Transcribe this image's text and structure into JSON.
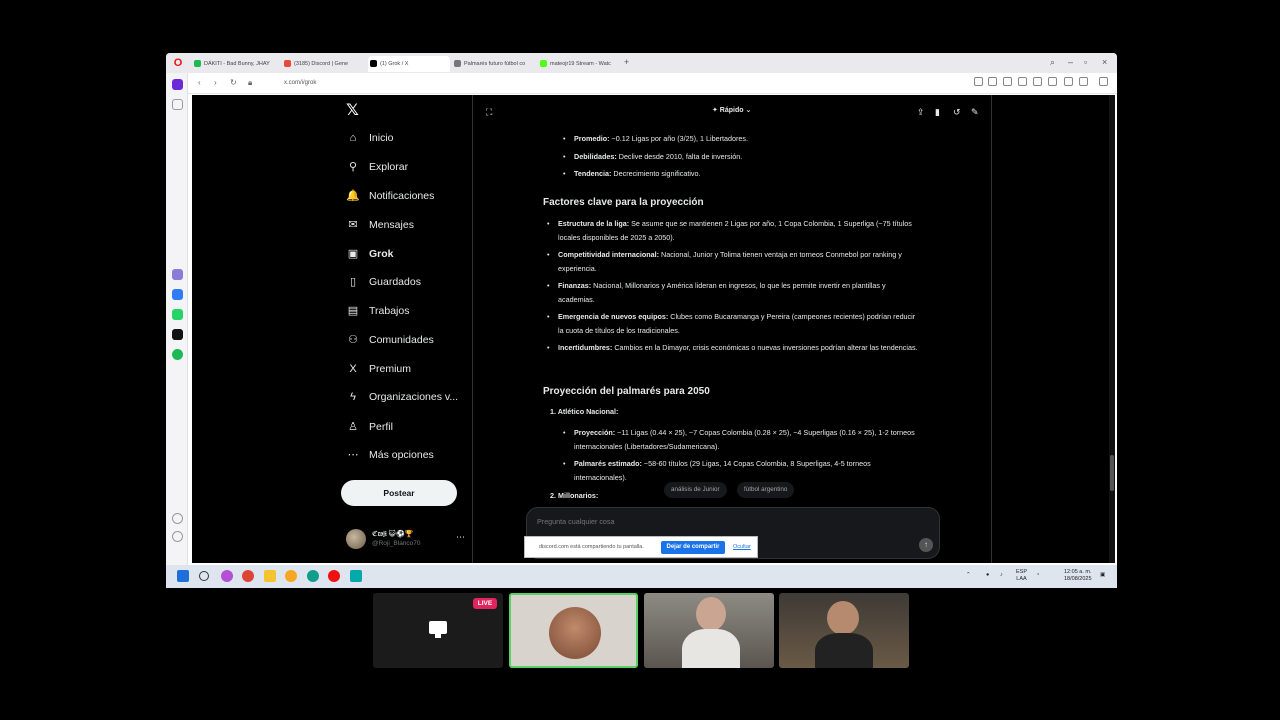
{
  "browser": {
    "tabs": [
      {
        "label": "DÁKITI - Bad Bunny, JHAY",
        "color": "#1db954"
      },
      {
        "label": "(3185) Discord | Gene",
        "color": "#e64a3c"
      },
      {
        "label": "(1) Grok / X",
        "color": "#000000"
      },
      {
        "label": "Palmarés futuro fútbol co",
        "color": "#777777"
      },
      {
        "label": "mateojr19 Stream - Watc",
        "color": "#53fc18"
      }
    ],
    "url": "x.com/i/grok",
    "new_tab": "+"
  },
  "sidebar": {
    "items": [
      {
        "label": "Inicio",
        "icon": "⌂"
      },
      {
        "label": "Explorar",
        "icon": "⚲"
      },
      {
        "label": "Notificaciones",
        "icon": "🔔"
      },
      {
        "label": "Mensajes",
        "icon": "✉"
      },
      {
        "label": "Grok",
        "icon": "▣"
      },
      {
        "label": "Guardados",
        "icon": "▯"
      },
      {
        "label": "Trabajos",
        "icon": "▤"
      },
      {
        "label": "Comunidades",
        "icon": "⚇"
      },
      {
        "label": "Premium",
        "icon": "X"
      },
      {
        "label": "Organizaciones v...",
        "icon": "ϟ"
      },
      {
        "label": "Perfil",
        "icon": "♙"
      },
      {
        "label": "Más opciones",
        "icon": "⋯"
      }
    ],
    "post_button": "Postear",
    "profile": {
      "name": "ℭ𝔯𝔬𝔧𝔦 😺⚽🏆",
      "handle": "@Roji_Blanco70",
      "more": "⋯"
    }
  },
  "grok": {
    "mode": "✦ Rápido ⌄",
    "bullets_top": [
      {
        "label": "Promedio:",
        "text": " ~0.12 Ligas por año (3/25), 1 Libertadores."
      },
      {
        "label": "Debilidades:",
        "text": " Declive desde 2010, falta de inversión."
      },
      {
        "label": "Tendencia:",
        "text": " Decrecimiento significativo."
      }
    ],
    "heading1": "Factores clave para la proyección",
    "factors": [
      {
        "label": "Estructura de la liga:",
        "text": " Se asume que se mantienen 2 Ligas por año, 1 Copa Colombia, 1 Superliga (~75 títulos locales disponibles de 2025 a 2050)."
      },
      {
        "label": "Competitividad internacional:",
        "text": " Nacional, Junior y Tolima tienen ventaja en torneos Conmebol por ranking y experiencia."
      },
      {
        "label": "Finanzas:",
        "text": " Nacional, Millonarios y América lideran en ingresos, lo que les permite invertir en plantillas y academias."
      },
      {
        "label": "Emergencia de nuevos equipos:",
        "text": " Clubes como Bucaramanga y Pereira (campeones recientes) podrían reducir la cuota de títulos de los tradicionales."
      },
      {
        "label": "Incertidumbres:",
        "text": " Cambios en la Dimayor, crisis económicas o nuevas inversiones podrían alterar las tendencias."
      }
    ],
    "heading2": "Proyección del palmarés para 2050",
    "item1": "1. Atlético Nacional:",
    "item1_bullets": [
      {
        "label": "Proyección:",
        "text": " ~11 Ligas (0.44 × 25), ~7 Copas Colombia (0.28 × 25), ~4 Superligas (0.16 × 25), 1-2 torneos internacionales (Libertadores/Sudamericana)."
      },
      {
        "label": "Palmarés estimado:",
        "text": " ~58-60 títulos (29 Ligas, 14 Copas Colombia, 8 Superligas, 4-5 torneos internacionales)."
      }
    ],
    "item2": "2. Millonarios:",
    "chips": [
      "análisis de Junior",
      "fútbol argentino"
    ],
    "ask_placeholder": "Pregunta cualquier cosa",
    "send_icon": "↑"
  },
  "share_bar": {
    "text": "discord.com está compartiendo tu pantalla.",
    "stop": "Dejar de compartir",
    "hide": "Ocultar"
  },
  "taskbar": {
    "lang": "ESP",
    "lang2": "LAA",
    "time": "12:05 a. m.",
    "date": "18/08/2025"
  },
  "call": {
    "live_badge": "LIVE"
  }
}
